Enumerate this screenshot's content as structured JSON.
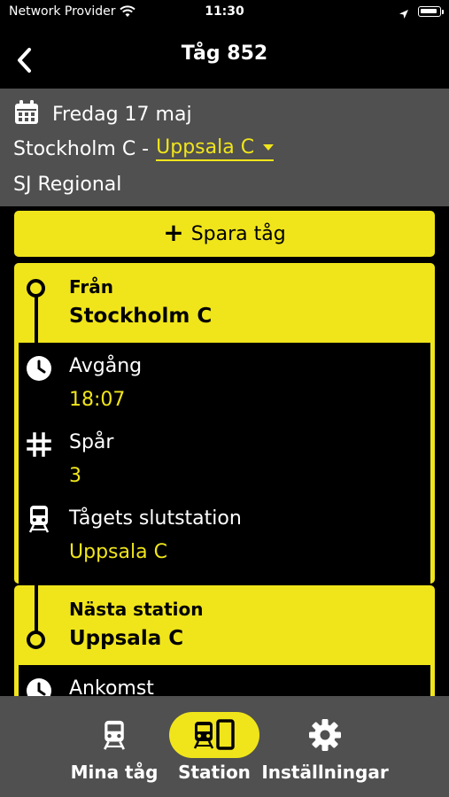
{
  "status_bar": {
    "carrier": "Network Provider",
    "time": "11:30"
  },
  "nav": {
    "title": "Tåg 852"
  },
  "journey": {
    "date": "Fredag 17 maj",
    "from": "Stockholm C -",
    "to": "Uppsala C",
    "operator": "SJ Regional"
  },
  "save_button": {
    "label": "Spara tåg"
  },
  "from_card": {
    "label": "Från",
    "station": "Stockholm C",
    "departure_label": "Avgång",
    "departure_time": "18:07",
    "track_label": "Spår",
    "track": "3",
    "terminus_label": "Tågets slutstation",
    "terminus": "Uppsala C"
  },
  "next_card": {
    "label": "Nästa station",
    "station": "Uppsala C",
    "arrival_label": "Ankomst"
  },
  "tabs": [
    {
      "label": "Mina tåg",
      "icon": "train-icon",
      "active": false
    },
    {
      "label": "Station",
      "icon": "station-icon",
      "active": true
    },
    {
      "label": "Inställningar",
      "icon": "gear-icon",
      "active": false
    }
  ],
  "colors": {
    "accent": "#f0e51b",
    "panel": "#505050",
    "background": "#000000"
  }
}
